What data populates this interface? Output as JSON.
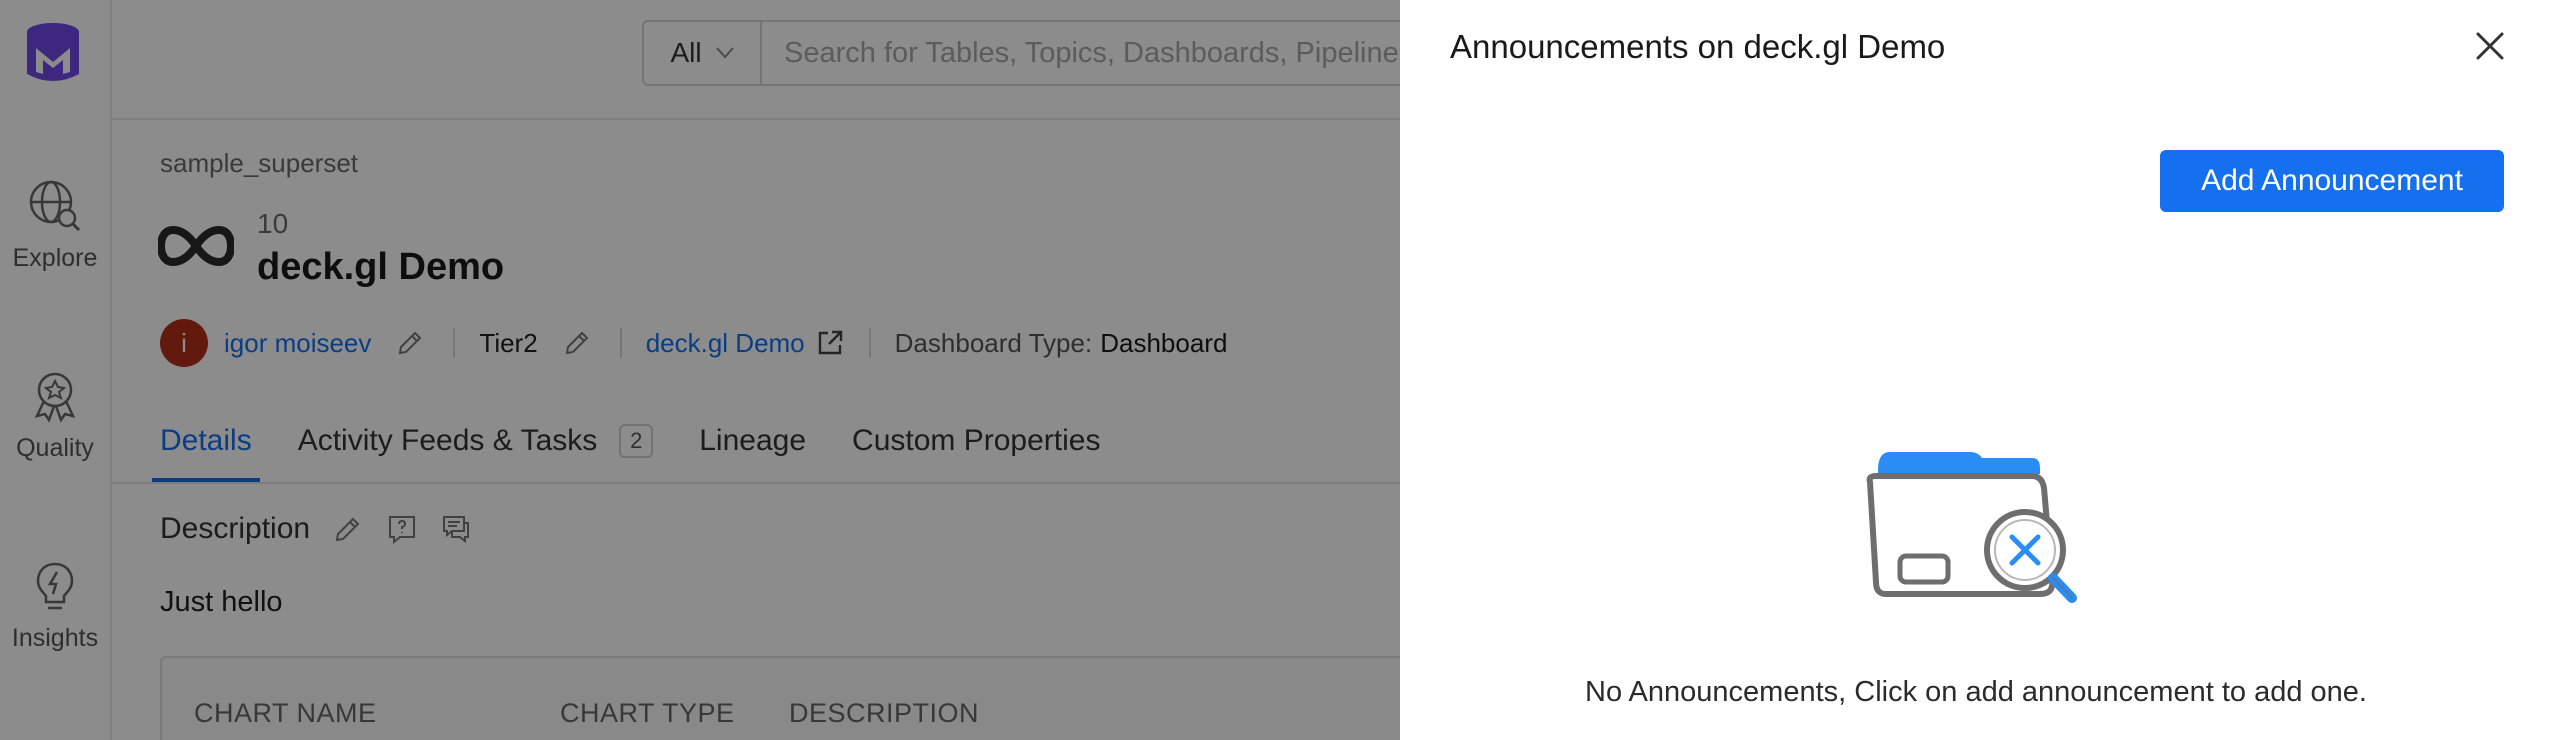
{
  "nav": {
    "items": [
      {
        "label": "Explore",
        "icon": "globe-search-icon"
      },
      {
        "label": "Quality",
        "icon": "badge-star-icon"
      },
      {
        "label": "Insights",
        "icon": "lightbulb-icon"
      }
    ]
  },
  "search": {
    "scope": "All",
    "placeholder": "Search for Tables, Topics, Dashboards, Pipelines, ML Models."
  },
  "entity": {
    "breadcrumb": "sample_superset",
    "id": "10",
    "name": "deck.gl Demo",
    "owner_initial": "i",
    "owner": "igor moiseev",
    "tier": "Tier2",
    "dashboard_link": "deck.gl Demo",
    "dashboard_type_label": "Dashboard Type:",
    "dashboard_type_value": "Dashboard"
  },
  "tabs": [
    {
      "label": "Details",
      "active": true
    },
    {
      "label": "Activity Feeds & Tasks",
      "count": "2"
    },
    {
      "label": "Lineage"
    },
    {
      "label": "Custom Properties"
    }
  ],
  "description": {
    "heading": "Description",
    "text": "Just hello"
  },
  "table": {
    "columns": [
      "CHART NAME",
      "CHART TYPE",
      "DESCRIPTION"
    ]
  },
  "drawer": {
    "title": "Announcements on deck.gl Demo",
    "add_button": "Add Announcement",
    "empty_text": "No Announcements, Click on add announcement to add one."
  },
  "colors": {
    "accent": "#1570ef",
    "avatar": "#b3301c",
    "logo": "#7147e8"
  }
}
